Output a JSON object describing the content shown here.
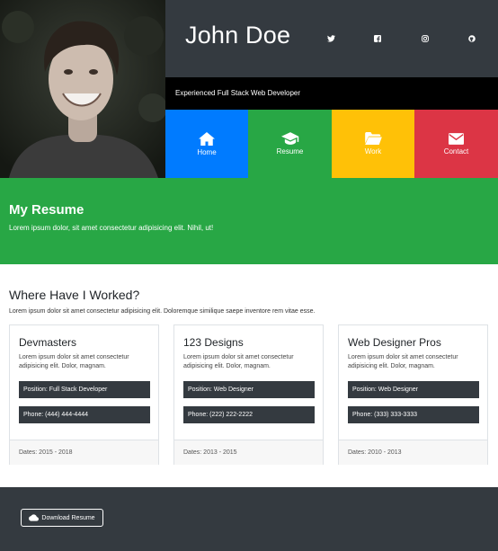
{
  "header": {
    "name": "John Doe",
    "tagline": "Experienced Full Stack Web Developer",
    "social": [
      {
        "icon": "twitter-icon"
      },
      {
        "icon": "facebook-icon"
      },
      {
        "icon": "instagram-icon"
      },
      {
        "icon": "github-icon"
      }
    ]
  },
  "nav": [
    {
      "label": "Home",
      "icon": "home-icon",
      "color": "#007bff"
    },
    {
      "label": "Resume",
      "icon": "graduation-cap-icon",
      "color": "#28a745"
    },
    {
      "label": "Work",
      "icon": "folder-icon",
      "color": "#ffc107"
    },
    {
      "label": "Contact",
      "icon": "envelope-icon",
      "color": "#dc3545"
    }
  ],
  "banner": {
    "title": "My Resume",
    "text": "Lorem ipsum dolor, sit amet consectetur adipisicing elit. Nihil, ut!"
  },
  "work": {
    "title": "Where Have I Worked?",
    "desc": "Lorem ipsum dolor sit amet consectetur adipisicing elit. Doloremque similique saepe inventore rem vitae esse.",
    "jobs": [
      {
        "company": "Devmasters",
        "desc": "Lorem ipsum dolor sit amet consectetur adipisicing elit. Dolor, magnam.",
        "position": "Position: Full Stack Developer",
        "phone": "Phone: (444) 444-4444",
        "dates": "Dates: 2015 - 2018"
      },
      {
        "company": "123 Designs",
        "desc": "Lorem ipsum dolor sit amet consectetur adipisicing elit. Dolor, magnam.",
        "position": "Position: Web Designer",
        "phone": "Phone: (222) 222-2222",
        "dates": "Dates: 2013 - 2015"
      },
      {
        "company": "Web Designer Pros",
        "desc": "Lorem ipsum dolor sit amet consectetur adipisicing elit. Dolor, magnam.",
        "position": "Position: Web Designer",
        "phone": "Phone: (333) 333-3333",
        "dates": "Dates: 2010 - 2013"
      }
    ]
  },
  "footer": {
    "download_label": "Download Resume"
  },
  "colors": {
    "dark": "#343a40",
    "green": "#28a745",
    "blue": "#007bff",
    "yellow": "#ffc107",
    "red": "#dc3545"
  }
}
